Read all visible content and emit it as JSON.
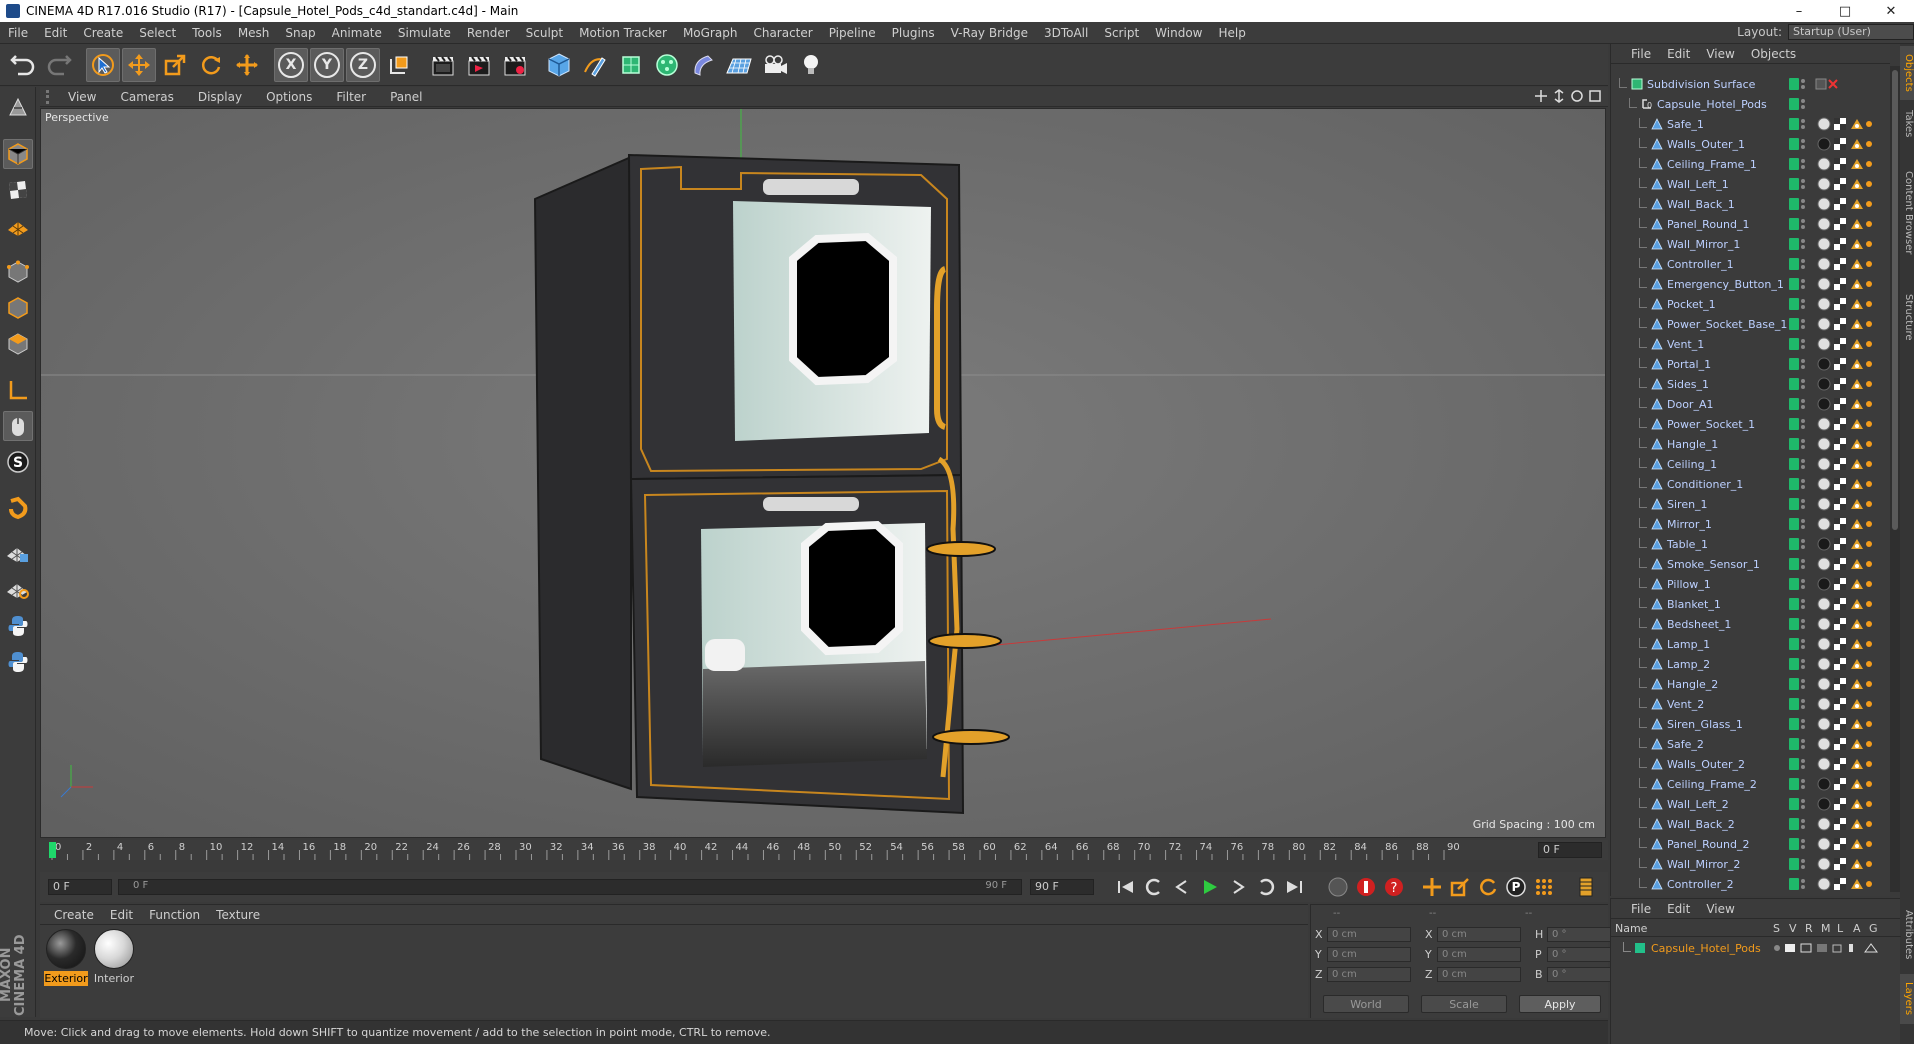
{
  "window": {
    "title": "CINEMA 4D R17.016 Studio (R17) - [Capsule_Hotel_Pods_c4d_standart.c4d] - Main",
    "min": "–",
    "max": "□",
    "close": "✕"
  },
  "menu": [
    "File",
    "Edit",
    "Create",
    "Select",
    "Tools",
    "Mesh",
    "Snap",
    "Animate",
    "Simulate",
    "Render",
    "Sculpt",
    "Motion Tracker",
    "MoGraph",
    "Character",
    "Pipeline",
    "Plugins",
    "V-Ray Bridge",
    "3DToAll",
    "Script",
    "Window",
    "Help"
  ],
  "layout": {
    "label": "Layout:",
    "value": "Startup (User)"
  },
  "viewport": {
    "menu": [
      "View",
      "Cameras",
      "Display",
      "Options",
      "Filter",
      "Panel"
    ],
    "camera": "Perspective",
    "grid_spacing": "Grid Spacing : 100 cm"
  },
  "timeline": {
    "ticks": [
      "0",
      "2",
      "4",
      "6",
      "8",
      "10",
      "12",
      "14",
      "16",
      "18",
      "20",
      "22",
      "24",
      "26",
      "28",
      "30",
      "32",
      "34",
      "36",
      "38",
      "40",
      "42",
      "44",
      "46",
      "48",
      "50",
      "52",
      "54",
      "56",
      "58",
      "60",
      "62",
      "64",
      "66",
      "68",
      "70",
      "72",
      "74",
      "76",
      "78",
      "80",
      "82",
      "84",
      "86",
      "88",
      "90"
    ],
    "current_frame": "0 F",
    "start": "0 F",
    "range_start": "0 F",
    "range_end": "90 F",
    "end": "90 F"
  },
  "material_menu": [
    "Create",
    "Edit",
    "Function",
    "Texture"
  ],
  "materials": [
    {
      "name": "Exterior",
      "selected": true,
      "color": "#2a2a2a"
    },
    {
      "name": "Interior",
      "selected": false,
      "color": "#d8d8d8"
    }
  ],
  "coordinates": {
    "header": [
      "--",
      "--",
      "--"
    ],
    "rows": [
      {
        "a1": "X",
        "v1": "0 cm",
        "a2": "X",
        "v2": "0 cm",
        "a3": "H",
        "v3": "0 °"
      },
      {
        "a1": "Y",
        "v1": "0 cm",
        "a2": "Y",
        "v2": "0 cm",
        "a3": "P",
        "v3": "0 °"
      },
      {
        "a1": "Z",
        "v1": "0 cm",
        "a2": "Z",
        "v2": "0 cm",
        "a3": "B",
        "v3": "0 °"
      }
    ],
    "world": "World",
    "scale": "Scale",
    "apply": "Apply"
  },
  "status": "Move: Click and drag to move elements. Hold down SHIFT to quantize movement / add to the selection in point mode, CTRL to remove.",
  "branding": "MAXON CINEMA 4D",
  "object_menu": [
    "File",
    "Edit",
    "View",
    "Objects"
  ],
  "objects": [
    {
      "name": "Subdivision Surface",
      "level": 0
    },
    {
      "name": "Capsule_Hotel_Pods",
      "level": 1
    },
    {
      "name": "Safe_1",
      "level": 2
    },
    {
      "name": "Walls_Outer_1",
      "level": 2
    },
    {
      "name": "Ceiling_Frame_1",
      "level": 2
    },
    {
      "name": "Wall_Left_1",
      "level": 2
    },
    {
      "name": "Wall_Back_1",
      "level": 2
    },
    {
      "name": "Panel_Round_1",
      "level": 2
    },
    {
      "name": "Wall_Mirror_1",
      "level": 2
    },
    {
      "name": "Controller_1",
      "level": 2
    },
    {
      "name": "Emergency_Button_1",
      "level": 2
    },
    {
      "name": "Pocket_1",
      "level": 2
    },
    {
      "name": "Power_Socket_Base_1",
      "level": 2
    },
    {
      "name": "Vent_1",
      "level": 2
    },
    {
      "name": "Portal_1",
      "level": 2
    },
    {
      "name": "Sides_1",
      "level": 2
    },
    {
      "name": "Door_A1",
      "level": 2
    },
    {
      "name": "Power_Socket_1",
      "level": 2
    },
    {
      "name": "Hangle_1",
      "level": 2
    },
    {
      "name": "Ceiling_1",
      "level": 2
    },
    {
      "name": "Conditioner_1",
      "level": 2
    },
    {
      "name": "Siren_1",
      "level": 2
    },
    {
      "name": "Mirror_1",
      "level": 2
    },
    {
      "name": "Table_1",
      "level": 2
    },
    {
      "name": "Smoke_Sensor_1",
      "level": 2
    },
    {
      "name": "Pillow_1",
      "level": 2
    },
    {
      "name": "Blanket_1",
      "level": 2
    },
    {
      "name": "Bedsheet_1",
      "level": 2
    },
    {
      "name": "Lamp_1",
      "level": 2
    },
    {
      "name": "Lamp_2",
      "level": 2
    },
    {
      "name": "Hangle_2",
      "level": 2
    },
    {
      "name": "Vent_2",
      "level": 2
    },
    {
      "name": "Siren_Glass_1",
      "level": 2
    },
    {
      "name": "Safe_2",
      "level": 2
    },
    {
      "name": "Walls_Outer_2",
      "level": 2
    },
    {
      "name": "Ceiling_Frame_2",
      "level": 2
    },
    {
      "name": "Wall_Left_2",
      "level": 2
    },
    {
      "name": "Wall_Back_2",
      "level": 2
    },
    {
      "name": "Panel_Round_2",
      "level": 2
    },
    {
      "name": "Wall_Mirror_2",
      "level": 2
    },
    {
      "name": "Controller_2",
      "level": 2
    }
  ],
  "side_tabs": [
    "Objects",
    "Takes",
    "Content Browser",
    "Structure"
  ],
  "side_tabs_bottom": [
    "Attributes",
    "Layers"
  ],
  "layer_menu": [
    "File",
    "Edit",
    "View"
  ],
  "layer_header": {
    "name": "Name",
    "cols": [
      "S",
      "V",
      "R",
      "M",
      "L",
      "A",
      "G"
    ]
  },
  "layers": [
    {
      "name": "Capsule_Hotel_Pods",
      "color": "#22c08a"
    }
  ],
  "colors": {
    "accent": "#f29b1c",
    "visible_green": "#1fb96a",
    "object_text": "#bcd0ff"
  }
}
